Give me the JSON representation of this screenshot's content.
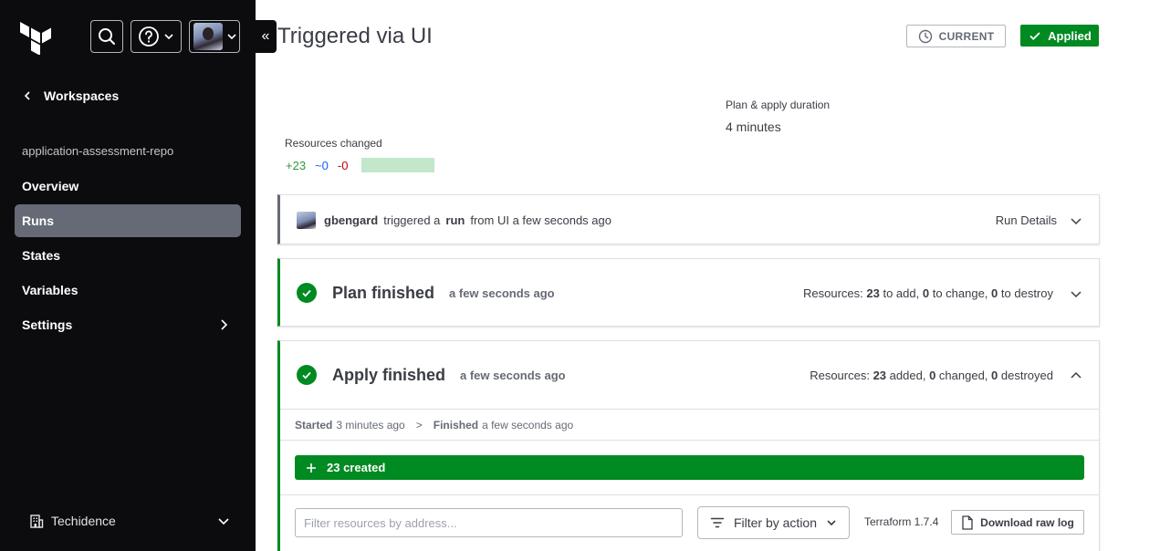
{
  "sidebar": {
    "back_label": "Workspaces",
    "workspace_name": "application-assessment-repo",
    "nav": [
      {
        "label": "Overview"
      },
      {
        "label": "Runs"
      },
      {
        "label": "States"
      },
      {
        "label": "Variables"
      },
      {
        "label": "Settings"
      }
    ],
    "org_name": "Techidence",
    "collapse_glyph": "«"
  },
  "header": {
    "title": "Triggered via UI",
    "current_label": "CURRENT",
    "status_label": "Applied"
  },
  "summary": {
    "duration_label": "Plan & apply duration",
    "duration_value": "4 minutes",
    "resources_label": "Resources changed",
    "added": "+23",
    "changed": "~0",
    "destroyed": "-0"
  },
  "trigger": {
    "user": "gbengard",
    "text1": "triggered a",
    "run_word": "run",
    "text2": "from UI a few seconds ago",
    "details_label": "Run Details"
  },
  "plan": {
    "title": "Plan finished",
    "time": "a few seconds ago",
    "res_prefix": "Resources:",
    "add": "23",
    "add_label": "to add,",
    "change": "0",
    "change_label": "to change,",
    "destroy": "0",
    "destroy_label": "to destroy"
  },
  "apply": {
    "title": "Apply finished",
    "time": "a few seconds ago",
    "res_prefix": "Resources:",
    "added": "23",
    "added_label": "added,",
    "changed": "0",
    "changed_label": "changed,",
    "destroyed": "0",
    "destroyed_label": "destroyed",
    "started_label": "Started",
    "started_time": "3 minutes ago",
    "separator": ">",
    "finished_label": "Finished",
    "finished_time": "a few seconds ago",
    "created_label": "23 created",
    "filter_placeholder": "Filter resources by address...",
    "filter_action_label": "Filter by action",
    "terraform_version": "Terraform 1.7.4",
    "download_label": "Download raw log"
  },
  "colors": {
    "success": "#008a22",
    "sidebar_bg": "#0c0c0e",
    "nav_active": "#656a76",
    "add": "#2b9a3b",
    "change": "#1060ff",
    "destroy": "#c00005"
  }
}
